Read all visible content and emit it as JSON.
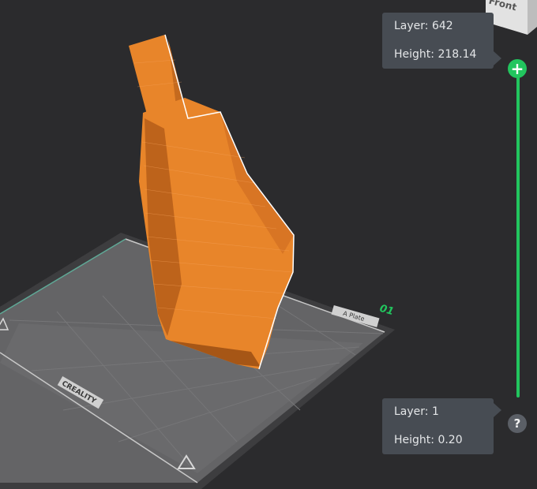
{
  "layer_slider": {
    "top": {
      "layer_text": "Layer: 642",
      "height_text": "Height: 218.14"
    },
    "bottom": {
      "layer_text": "Layer: 1",
      "height_text": "Height: 0.20"
    },
    "handle_symbol": "+",
    "accent_color": "#22c55e"
  },
  "view_cube": {
    "face_label": "Front"
  },
  "build_plate": {
    "plate_number": "01",
    "plate_label": "A Plate",
    "brand": "CREALITY"
  },
  "model": {
    "color": "#e8852a"
  },
  "help": {
    "symbol": "?"
  }
}
